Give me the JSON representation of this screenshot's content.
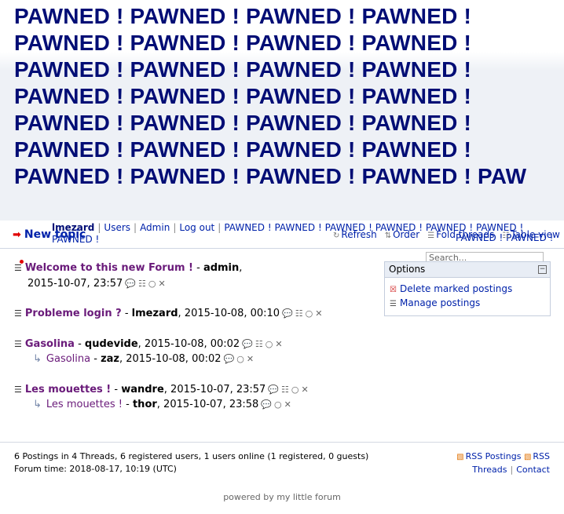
{
  "header": {
    "title_banner": "PAWNED ! PAWNED ! PAWNED ! PAWNED ! PAWNED ! PAWNED ! PAWNED ! PAWNED ! PAWNED ! PAWNED ! PAWNED ! PAWNED ! PAWNED ! PAWNED ! PAWNED ! PAWNED ! PAWNED ! PAWNED ! PAWNED ! PAWNED ! PAWNED ! PAWNED ! PAWNED ! PAWNED ! PAWNED ! PAWNED ! PAWNED ! PAWNED ! PAW"
  },
  "usernav": {
    "username": "lmezard",
    "users": "Users",
    "admin": "Admin",
    "logout": "Log out",
    "custom_link": "PAWNED ! PAWNED ! PAWNED ! PAWNED ! PAWNED ! PAWNED ! PAWNED !",
    "custom_link_tail": "PAWNED ! PAWNED !"
  },
  "subnav": {
    "new_topic": "New topic",
    "refresh": "Refresh",
    "order": "Order",
    "fold_threads": "Fold threads",
    "table_view": "Table view"
  },
  "search": {
    "placeholder": "Search..."
  },
  "options": {
    "title": "Options",
    "delete_marked": "Delete marked postings",
    "manage": "Manage postings"
  },
  "threads": [
    {
      "subject": "Welcome to this new Forum !",
      "author": "admin",
      "date": "2015-10-07, 23:57",
      "new": true
    },
    {
      "subject": "Probleme login ?",
      "author": "lmezard",
      "date": "2015-10-08, 00:10"
    },
    {
      "subject": "Gasolina",
      "author": "qudevide",
      "date": "2015-10-08, 00:02",
      "reply": {
        "subject": "Gasolina",
        "author": "zaz",
        "date": "2015-10-08, 00:02"
      }
    },
    {
      "subject": "Les mouettes !",
      "author": "wandre",
      "date": "2015-10-07, 23:57",
      "reply": {
        "subject": "Les mouettes !",
        "author": "thor",
        "date": "2015-10-07, 23:58"
      }
    }
  ],
  "footer": {
    "stats": "6 Postings in 4 Threads, 6 registered users, 1 users online (1 registered, 0 guests)",
    "forum_time": "Forum time: 2018-08-17, 10:19 (UTC)",
    "rss_postings": "RSS Postings",
    "rss": "RSS",
    "threads": "Threads",
    "contact": "Contact",
    "powered": "powered by my little forum"
  },
  "colors": {
    "banner_text": "#000d75",
    "link": "#0022aa",
    "subject": "#6a1b7a"
  }
}
